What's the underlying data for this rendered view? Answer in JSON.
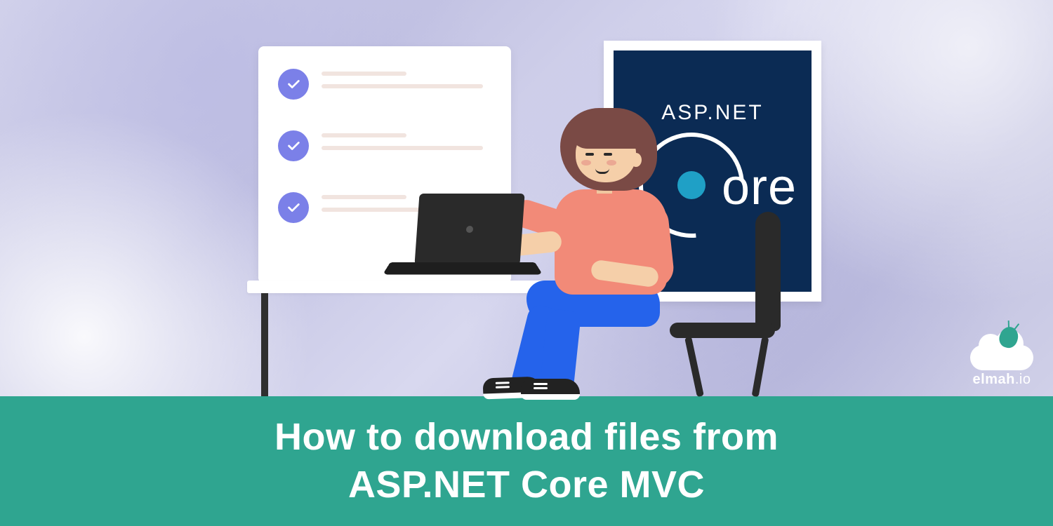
{
  "title": {
    "line1": "How to download files from",
    "line2": "ASP.NET Core MVC"
  },
  "poster": {
    "top_label": "ASP.NET",
    "core_suffix": "ore"
  },
  "logo": {
    "text_main": "elmah",
    "text_suffix": ".io"
  },
  "colors": {
    "title_bar": "#2fa590",
    "poster_bg": "#0b2b54",
    "poster_dot": "#1fa0c6",
    "check_circle": "#7b80e8",
    "shirt": "#f28a78",
    "pants": "#2563eb",
    "hair": "#7a4a45",
    "skin": "#f5cfa9"
  }
}
